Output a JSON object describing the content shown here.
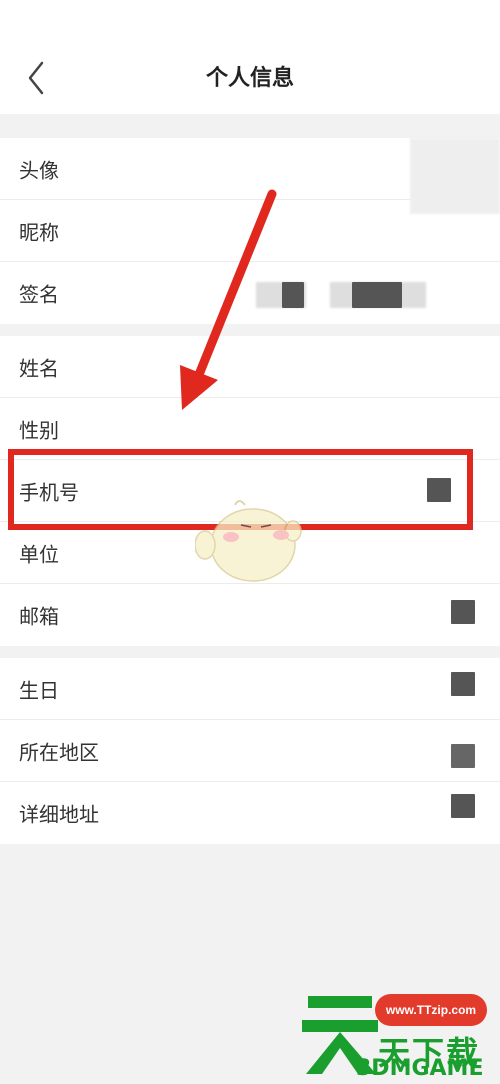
{
  "header": {
    "title": "个人信息",
    "back_icon": "chevron-left-icon"
  },
  "sections": [
    {
      "rows": [
        {
          "label": "头像",
          "key": "avatar"
        },
        {
          "label": "昵称",
          "key": "nickname"
        },
        {
          "label": "签名",
          "key": "signature"
        }
      ]
    },
    {
      "rows": [
        {
          "label": "姓名",
          "key": "name"
        },
        {
          "label": "性别",
          "key": "gender"
        },
        {
          "label": "手机号",
          "key": "phone"
        },
        {
          "label": "单位",
          "key": "company"
        },
        {
          "label": "邮箱",
          "key": "email"
        }
      ]
    },
    {
      "rows": [
        {
          "label": "生日",
          "key": "birthday"
        },
        {
          "label": "所在地区",
          "key": "region"
        },
        {
          "label": "详细地址",
          "key": "address"
        }
      ]
    }
  ],
  "annotation": {
    "color": "#e0281e",
    "highlighted_row": "手机号"
  },
  "watermark": {
    "url": "www.TTzip.com",
    "name": "天下载",
    "brand": "3DMGAME",
    "color": "#1a9f2e"
  }
}
